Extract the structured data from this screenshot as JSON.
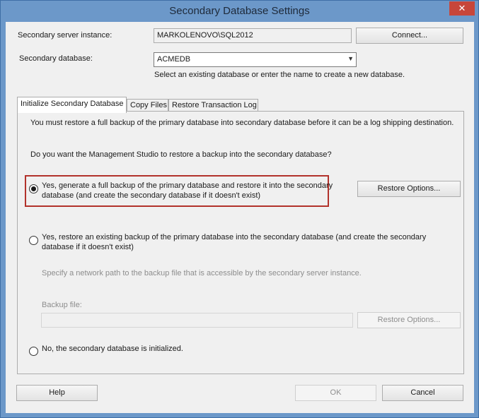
{
  "window": {
    "title": "Secondary Database Settings",
    "close_glyph": "✕"
  },
  "server": {
    "label": "Secondary server instance:",
    "value": "MARKOLENOVO\\SQL2012",
    "connect_button": "Connect..."
  },
  "database": {
    "label": "Secondary database:",
    "value": "ACMEDB",
    "hint": "Select an existing database or enter the name to create a new database."
  },
  "tabs": [
    {
      "label": "Initialize Secondary Database"
    },
    {
      "label": "Copy Files"
    },
    {
      "label": "Restore Transaction Log"
    }
  ],
  "panel": {
    "intro": "You must restore a full backup of the primary database into secondary database before it can be a log shipping destination.",
    "question": "Do you want the Management Studio to restore a backup into the secondary database?",
    "option1_line1": "Yes, generate a full backup of the primary database and restore it into the secondary",
    "option1_line2": "database (and create the secondary database if it doesn't exist)",
    "option1_checked": true,
    "restore_options_button": "Restore Options...",
    "option2_line1": "Yes, restore an existing backup of the primary database into the secondary database (and create the secondary",
    "option2_line2": "database if it doesn't exist)",
    "network_path_hint": "Specify a network path to the backup file that is accessible by the secondary server instance.",
    "backup_file_label": "Backup file:",
    "backup_file_value": "",
    "restore_options_button_disabled": "Restore Options...",
    "option3_label": "No, the secondary database is initialized."
  },
  "footer": {
    "help": "Help",
    "ok": "OK",
    "cancel": "Cancel"
  }
}
